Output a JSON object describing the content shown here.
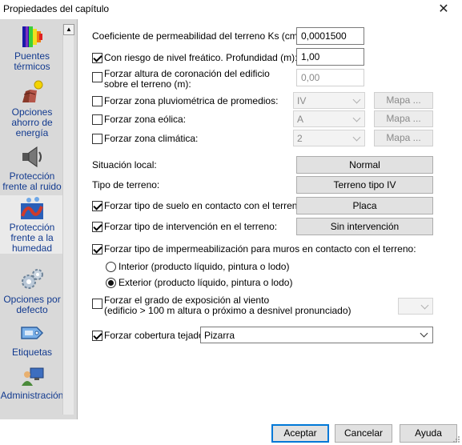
{
  "window": {
    "title": "Propiedades del capítulo",
    "close_icon": "close-icon"
  },
  "sidebar": {
    "scroll_up_icon": "scroll-up-icon",
    "items": [
      {
        "label": "Puentes térmicos",
        "icon": "thermal-bridge-icon"
      },
      {
        "label": "Opciones ahorro de energía",
        "icon": "energy-saving-icon"
      },
      {
        "label": "Protección frente al ruido",
        "icon": "speaker-icon"
      },
      {
        "label": "Protección frente a la humedad",
        "icon": "humidity-icon"
      },
      {
        "label": "Opciones por defecto",
        "icon": "gears-icon"
      },
      {
        "label": "Etiquetas",
        "icon": "tag-icon"
      },
      {
        "label": "Administración",
        "icon": "admin-icon"
      }
    ]
  },
  "form": {
    "permeabilidad": {
      "label": "Coeficiente de permeabilidad del terreno Ks (cm/s):",
      "value": "0,0001500"
    },
    "freatico": {
      "label": "Con riesgo de nivel freático. Profundidad (m):",
      "checked": true,
      "value": "1,00"
    },
    "coronacion": {
      "label_line1": "Forzar altura de coronación del edificio",
      "label_line2": "sobre el terreno (m):",
      "checked": false,
      "value": "0,00"
    },
    "pluviometrica": {
      "label": "Forzar zona pluviométrica de promedios:",
      "checked": false,
      "value": "IV",
      "map_button": "Mapa ..."
    },
    "eolica": {
      "label": "Forzar zona eólica:",
      "checked": false,
      "value": "A",
      "map_button": "Mapa ..."
    },
    "climatica": {
      "label": "Forzar zona climática:",
      "checked": false,
      "value": "2",
      "map_button": "Mapa ..."
    },
    "situacion": {
      "label": "Situación local:",
      "button": "Normal"
    },
    "terreno": {
      "label": "Tipo de terreno:",
      "button": "Terreno tipo IV"
    },
    "suelo": {
      "label": "Forzar tipo de suelo en contacto con el terreno:",
      "checked": true,
      "button": "Placa"
    },
    "intervencion": {
      "label": "Forzar tipo de intervención en el terreno:",
      "checked": true,
      "button": "Sin intervención"
    },
    "impermeabilizacion": {
      "label": "Forzar tipo de impermeabilización para muros en contacto con el terreno:",
      "checked": true
    },
    "radio_interior": {
      "label": "Interior (producto líquido, pintura o lodo)",
      "checked": false
    },
    "radio_exterior": {
      "label": "Exterior (producto líquido, pintura o lodo)",
      "checked": true
    },
    "exposicion": {
      "label_line1": "Forzar el grado de exposición al viento",
      "label_line2": "(edificio > 100 m altura o próximo a desnivel pronunciado)",
      "checked": false,
      "value": ""
    },
    "cobertura": {
      "label": "Forzar cobertura tejado:",
      "checked": true,
      "value": "Pizarra"
    }
  },
  "footer": {
    "accept": "Aceptar",
    "cancel": "Cancelar",
    "help": "Ayuda"
  }
}
